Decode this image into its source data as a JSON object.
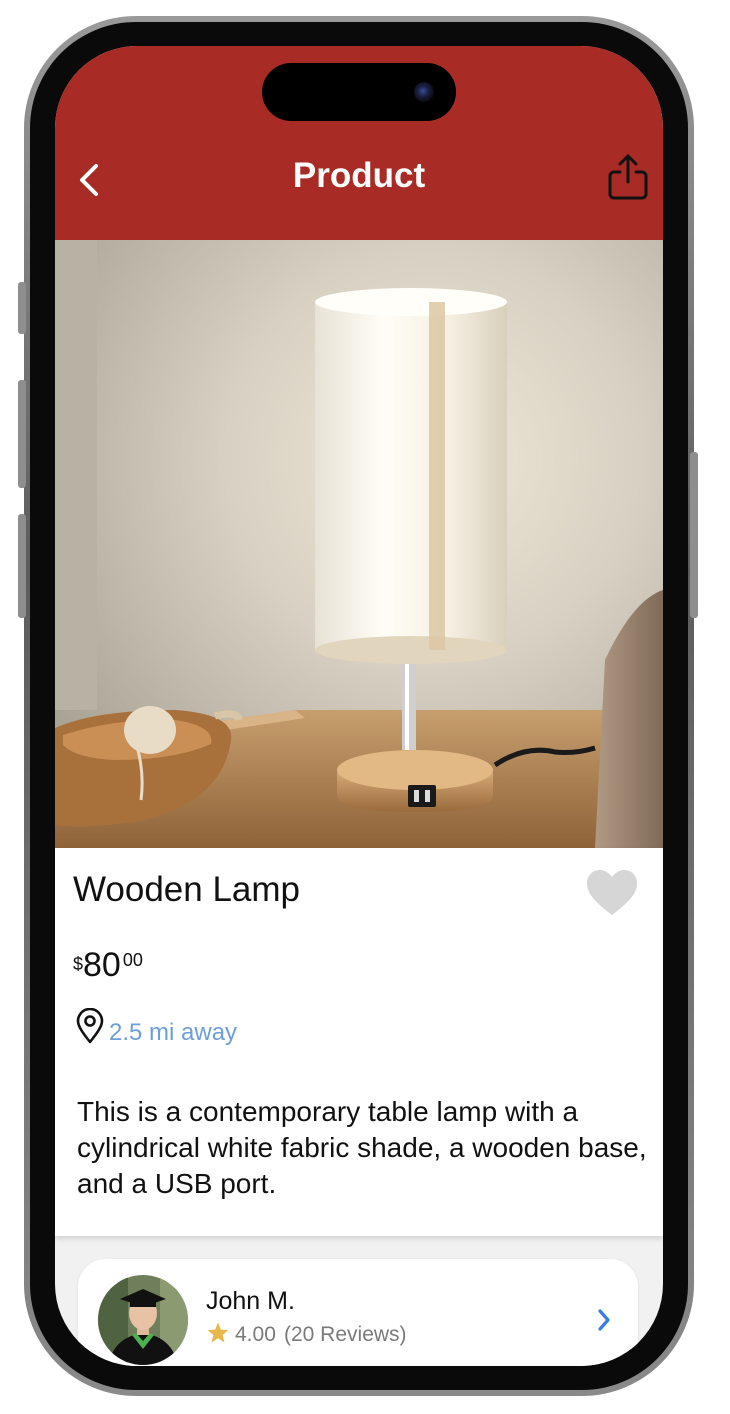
{
  "header": {
    "title": "Product",
    "back_icon": "chevron-left-icon",
    "share_icon": "share-icon",
    "background_color": "#a82c25"
  },
  "product": {
    "name": "Wooden Lamp",
    "price": {
      "currency": "$",
      "whole": "80",
      "cents": "00"
    },
    "distance": "2.5 mi away",
    "description": "This is a contemporary table lamp with a cylindrical white fabric shade, a wooden base, and a USB port.",
    "favorite_icon": "heart-icon",
    "location_icon": "location-pin-icon"
  },
  "seller": {
    "name": "John M.",
    "rating": "4.00",
    "reviews": "(20 Reviews)",
    "star_color": "#e8b84a",
    "link_color": "#3b7be0"
  },
  "colors": {
    "distance_text": "#6d9fd6",
    "heart": "#d6d6d6"
  }
}
